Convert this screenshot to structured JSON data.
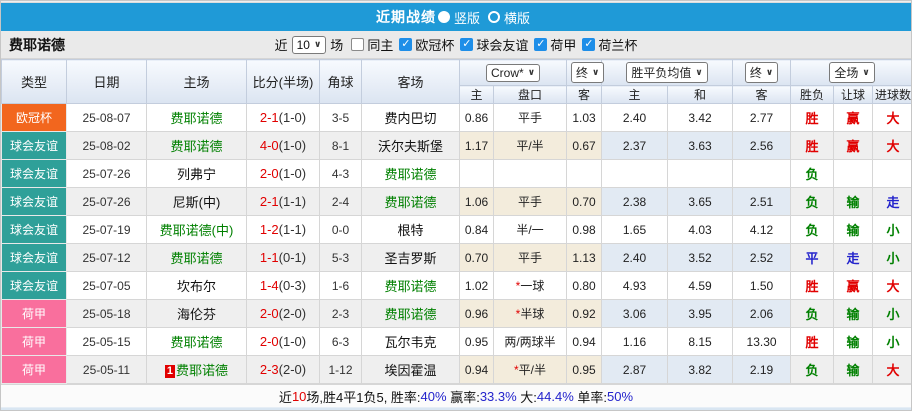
{
  "colors": {
    "titlebar": "#1F9AD7",
    "checkbox": "#1E8EE8",
    "cup": "#F2661E",
    "friendly": "#2FA099",
    "league": "#F96F9D",
    "red": "#E10000",
    "green": "#008000",
    "blue": "#2323CC",
    "black": "#111111"
  },
  "title_bar": {
    "title": "近期战绩",
    "options": [
      {
        "label": "竖版",
        "selected": true
      },
      {
        "label": "横版",
        "selected": false
      }
    ]
  },
  "filter_bar": {
    "team": "费耶诺德",
    "near": "近",
    "count": "10",
    "suffix": "场",
    "same_home": "同主",
    "same_home_checked": false,
    "leagues": [
      {
        "label": "欧冠杯",
        "checked": true
      },
      {
        "label": "球会友谊",
        "checked": true
      },
      {
        "label": "荷甲",
        "checked": true
      },
      {
        "label": "荷兰杯",
        "checked": true
      }
    ]
  },
  "table": {
    "headers": {
      "type": "类型",
      "date": "日期",
      "home": "主场",
      "score": "比分(半场)",
      "corner": "角球",
      "away": "客场",
      "dropdowns": [
        "Crow*",
        "终",
        "胜平负均值",
        "终",
        "全场"
      ],
      "sub": [
        "主",
        "盘口",
        "客",
        "主",
        "和",
        "客",
        "胜负",
        "让球",
        "进球数"
      ]
    },
    "rows": [
      {
        "type": "欧冠杯",
        "type_key": "cup",
        "date": "25-08-07",
        "home": "费耶诺德",
        "home_green": true,
        "badge": "",
        "score": "2-1",
        "half": "(1-0)",
        "corner": "3-5",
        "away": "费内巴切",
        "away_green": false,
        "o_home": "0.86",
        "star": false,
        "handicap": "平手",
        "o_away": "1.03",
        "a_home": "2.40",
        "a_draw": "3.42",
        "a_away": "2.77",
        "res": [
          {
            "t": "胜",
            "c": "red"
          },
          {
            "t": "赢",
            "c": "red"
          },
          {
            "t": "大",
            "c": "red"
          }
        ]
      },
      {
        "type": "球会友谊",
        "type_key": "friendly",
        "date": "25-08-02",
        "home": "费耶诺德",
        "home_green": true,
        "badge": "",
        "score": "4-0",
        "half": "(1-0)",
        "corner": "8-1",
        "away": "沃尔夫斯堡",
        "away_green": false,
        "o_home": "1.17",
        "star": false,
        "handicap": "平/半",
        "o_away": "0.67",
        "a_home": "2.37",
        "a_draw": "3.63",
        "a_away": "2.56",
        "res": [
          {
            "t": "胜",
            "c": "red"
          },
          {
            "t": "赢",
            "c": "red"
          },
          {
            "t": "大",
            "c": "red"
          }
        ]
      },
      {
        "type": "球会友谊",
        "type_key": "friendly",
        "date": "25-07-26",
        "home": "列弗宁",
        "home_green": false,
        "badge": "",
        "score": "2-0",
        "half": "(1-0)",
        "corner": "4-3",
        "away": "费耶诺德",
        "away_green": true,
        "o_home": "",
        "star": false,
        "handicap": "",
        "o_away": "",
        "a_home": "",
        "a_draw": "",
        "a_away": "",
        "res": [
          {
            "t": "负",
            "c": "green"
          },
          {
            "t": "",
            "c": "black"
          },
          {
            "t": "",
            "c": "black"
          }
        ]
      },
      {
        "type": "球会友谊",
        "type_key": "friendly",
        "date": "25-07-26",
        "home": "尼斯(中)",
        "home_green": false,
        "badge": "",
        "score": "2-1",
        "half": "(1-1)",
        "corner": "2-4",
        "away": "费耶诺德",
        "away_green": true,
        "o_home": "1.06",
        "star": false,
        "handicap": "平手",
        "o_away": "0.70",
        "a_home": "2.38",
        "a_draw": "3.65",
        "a_away": "2.51",
        "res": [
          {
            "t": "负",
            "c": "green"
          },
          {
            "t": "输",
            "c": "green"
          },
          {
            "t": "走",
            "c": "blue"
          }
        ]
      },
      {
        "type": "球会友谊",
        "type_key": "friendly",
        "date": "25-07-19",
        "home": "费耶诺德(中)",
        "home_green": true,
        "badge": "",
        "score": "1-2",
        "half": "(1-1)",
        "corner": "0-0",
        "away": "根特",
        "away_green": false,
        "o_home": "0.84",
        "star": false,
        "handicap": "半/一",
        "o_away": "0.98",
        "a_home": "1.65",
        "a_draw": "4.03",
        "a_away": "4.12",
        "res": [
          {
            "t": "负",
            "c": "green"
          },
          {
            "t": "输",
            "c": "green"
          },
          {
            "t": "小",
            "c": "green"
          }
        ]
      },
      {
        "type": "球会友谊",
        "type_key": "friendly",
        "date": "25-07-12",
        "home": "费耶诺德",
        "home_green": true,
        "badge": "",
        "score": "1-1",
        "half": "(0-1)",
        "corner": "5-3",
        "away": "圣吉罗斯",
        "away_green": false,
        "o_home": "0.70",
        "star": false,
        "handicap": "平手",
        "o_away": "1.13",
        "a_home": "2.40",
        "a_draw": "3.52",
        "a_away": "2.52",
        "res": [
          {
            "t": "平",
            "c": "blue"
          },
          {
            "t": "走",
            "c": "blue"
          },
          {
            "t": "小",
            "c": "green"
          }
        ]
      },
      {
        "type": "球会友谊",
        "type_key": "friendly",
        "date": "25-07-05",
        "home": "坎布尔",
        "home_green": false,
        "badge": "",
        "score": "1-4",
        "half": "(0-3)",
        "corner": "1-6",
        "away": "费耶诺德",
        "away_green": true,
        "o_home": "1.02",
        "star": true,
        "handicap": "一球",
        "o_away": "0.80",
        "a_home": "4.93",
        "a_draw": "4.59",
        "a_away": "1.50",
        "res": [
          {
            "t": "胜",
            "c": "red"
          },
          {
            "t": "赢",
            "c": "red"
          },
          {
            "t": "大",
            "c": "red"
          }
        ]
      },
      {
        "type": "荷甲",
        "type_key": "league",
        "date": "25-05-18",
        "home": "海伦芬",
        "home_green": false,
        "badge": "",
        "score": "2-0",
        "half": "(2-0)",
        "corner": "2-3",
        "away": "费耶诺德",
        "away_green": true,
        "o_home": "0.96",
        "star": true,
        "handicap": "半球",
        "o_away": "0.92",
        "a_home": "3.06",
        "a_draw": "3.95",
        "a_away": "2.06",
        "res": [
          {
            "t": "负",
            "c": "green"
          },
          {
            "t": "输",
            "c": "green"
          },
          {
            "t": "小",
            "c": "green"
          }
        ]
      },
      {
        "type": "荷甲",
        "type_key": "league",
        "date": "25-05-15",
        "home": "费耶诺德",
        "home_green": true,
        "badge": "",
        "score": "2-0",
        "half": "(1-0)",
        "corner": "6-3",
        "away": "瓦尔韦克",
        "away_green": false,
        "o_home": "0.95",
        "star": false,
        "handicap": "两/两球半",
        "o_away": "0.94",
        "a_home": "1.16",
        "a_draw": "8.15",
        "a_away": "13.30",
        "res": [
          {
            "t": "胜",
            "c": "red"
          },
          {
            "t": "输",
            "c": "green"
          },
          {
            "t": "小",
            "c": "green"
          }
        ]
      },
      {
        "type": "荷甲",
        "type_key": "league",
        "date": "25-05-11",
        "home": "费耶诺德",
        "home_green": true,
        "badge": "1",
        "score": "2-3",
        "half": "(2-0)",
        "corner": "1-12",
        "away": "埃因霍温",
        "away_green": false,
        "o_home": "0.94",
        "star": true,
        "handicap": "平/半",
        "o_away": "0.95",
        "a_home": "2.87",
        "a_draw": "3.82",
        "a_away": "2.19",
        "res": [
          {
            "t": "负",
            "c": "green"
          },
          {
            "t": "输",
            "c": "green"
          },
          {
            "t": "大",
            "c": "red"
          }
        ]
      }
    ]
  },
  "footer": {
    "segments": [
      {
        "t": "近",
        "c": "black"
      },
      {
        "t": "10",
        "c": "red"
      },
      {
        "t": "场,胜4平1负5, 胜率:",
        "c": "black"
      },
      {
        "t": "40%",
        "c": "blue"
      },
      {
        "t": " 赢率:",
        "c": "black"
      },
      {
        "t": "33.3%",
        "c": "blue"
      },
      {
        "t": " 大:",
        "c": "black"
      },
      {
        "t": "44.4%",
        "c": "blue"
      },
      {
        "t": " 单率:",
        "c": "black"
      },
      {
        "t": "50%",
        "c": "blue"
      }
    ]
  }
}
